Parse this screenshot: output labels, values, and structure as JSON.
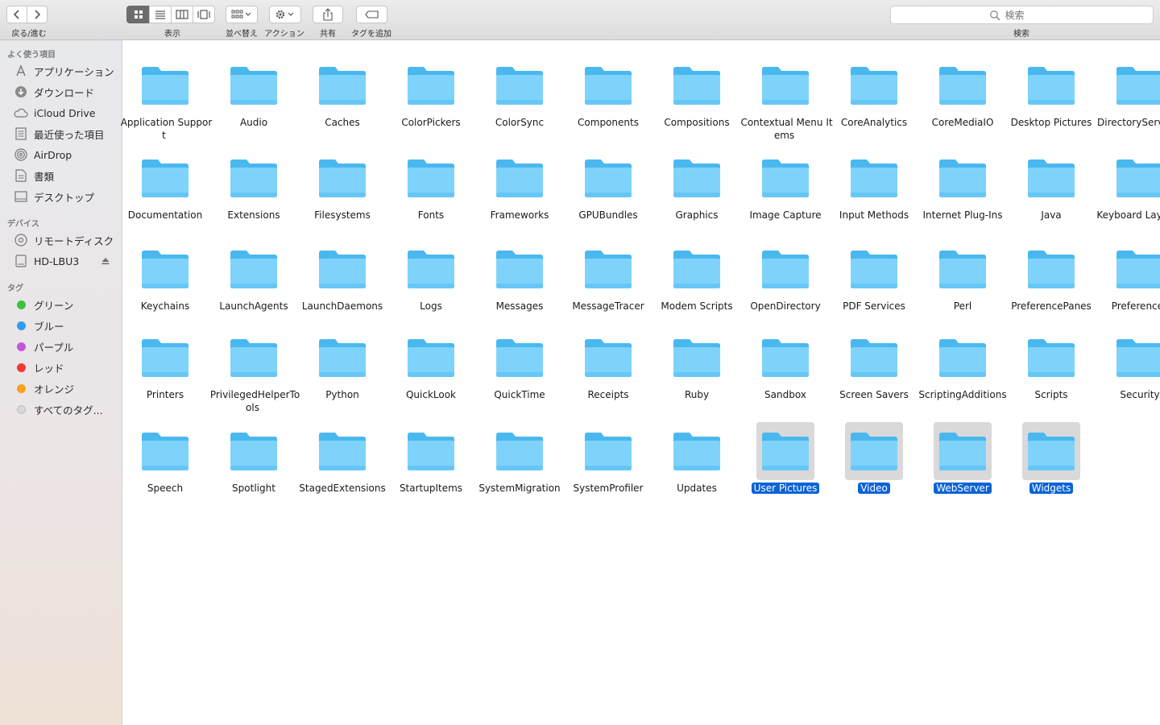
{
  "toolbar": {
    "nav_label": "戻る/進む",
    "view_label": "表示",
    "sort_label": "並べ替え",
    "action_label": "アクション",
    "share_label": "共有",
    "tag_label": "タグを追加",
    "search_label": "検索",
    "search_placeholder": "検索"
  },
  "sidebar": {
    "favorites_header": "よく使う項目",
    "favorites": [
      {
        "label": "アプリケーション",
        "icon": "applications-icon"
      },
      {
        "label": "ダウンロード",
        "icon": "download-icon"
      },
      {
        "label": "iCloud Drive",
        "icon": "cloud-icon"
      },
      {
        "label": "最近使った項目",
        "icon": "recents-icon"
      },
      {
        "label": "AirDrop",
        "icon": "airdrop-icon"
      },
      {
        "label": "書類",
        "icon": "documents-icon"
      },
      {
        "label": "デスクトップ",
        "icon": "desktop-icon"
      }
    ],
    "devices_header": "デバイス",
    "devices": [
      {
        "label": "リモートディスク",
        "icon": "disc-icon"
      },
      {
        "label": "HD-LBU3",
        "icon": "drive-icon"
      }
    ],
    "tags_header": "タグ",
    "tags": [
      {
        "label": "グリーン",
        "color": "#3ec13e"
      },
      {
        "label": "ブルー",
        "color": "#2f9cf0"
      },
      {
        "label": "パープル",
        "color": "#c557d6"
      },
      {
        "label": "レッド",
        "color": "#f23a35"
      },
      {
        "label": "オレンジ",
        "color": "#f7a21c"
      },
      {
        "label": "すべてのタグ...",
        "color": "#d8d8d8"
      }
    ]
  },
  "folders": [
    {
      "name": "Application Support",
      "selected": false
    },
    {
      "name": "Audio",
      "selected": false
    },
    {
      "name": "Caches",
      "selected": false
    },
    {
      "name": "ColorPickers",
      "selected": false
    },
    {
      "name": "ColorSync",
      "selected": false
    },
    {
      "name": "Components",
      "selected": false
    },
    {
      "name": "Compositions",
      "selected": false
    },
    {
      "name": "Contextual Menu Items",
      "selected": false
    },
    {
      "name": "CoreAnalytics",
      "selected": false
    },
    {
      "name": "CoreMediaIO",
      "selected": false
    },
    {
      "name": "Desktop Pictures",
      "selected": false
    },
    {
      "name": "DirectoryServices",
      "selected": false
    },
    {
      "name": "Documentation",
      "selected": false
    },
    {
      "name": "Extensions",
      "selected": false
    },
    {
      "name": "Filesystems",
      "selected": false
    },
    {
      "name": "Fonts",
      "selected": false
    },
    {
      "name": "Frameworks",
      "selected": false
    },
    {
      "name": "GPUBundles",
      "selected": false
    },
    {
      "name": "Graphics",
      "selected": false
    },
    {
      "name": "Image Capture",
      "selected": false
    },
    {
      "name": "Input Methods",
      "selected": false
    },
    {
      "name": "Internet Plug-Ins",
      "selected": false
    },
    {
      "name": "Java",
      "selected": false
    },
    {
      "name": "Keyboard Layouts",
      "selected": false
    },
    {
      "name": "Keychains",
      "selected": false
    },
    {
      "name": "LaunchAgents",
      "selected": false
    },
    {
      "name": "LaunchDaemons",
      "selected": false
    },
    {
      "name": "Logs",
      "selected": false
    },
    {
      "name": "Messages",
      "selected": false
    },
    {
      "name": "MessageTracer",
      "selected": false
    },
    {
      "name": "Modem Scripts",
      "selected": false
    },
    {
      "name": "OpenDirectory",
      "selected": false
    },
    {
      "name": "PDF Services",
      "selected": false
    },
    {
      "name": "Perl",
      "selected": false
    },
    {
      "name": "PreferencePanes",
      "selected": false
    },
    {
      "name": "Preferences",
      "selected": false
    },
    {
      "name": "Printers",
      "selected": false
    },
    {
      "name": "PrivilegedHelperTools",
      "selected": false
    },
    {
      "name": "Python",
      "selected": false
    },
    {
      "name": "QuickLook",
      "selected": false
    },
    {
      "name": "QuickTime",
      "selected": false
    },
    {
      "name": "Receipts",
      "selected": false
    },
    {
      "name": "Ruby",
      "selected": false
    },
    {
      "name": "Sandbox",
      "selected": false
    },
    {
      "name": "Screen Savers",
      "selected": false
    },
    {
      "name": "ScriptingAdditions",
      "selected": false
    },
    {
      "name": "Scripts",
      "selected": false
    },
    {
      "name": "Security",
      "selected": false
    },
    {
      "name": "Speech",
      "selected": false
    },
    {
      "name": "Spotlight",
      "selected": false
    },
    {
      "name": "StagedExtensions",
      "selected": false
    },
    {
      "name": "StartupItems",
      "selected": false
    },
    {
      "name": "SystemMigration",
      "selected": false
    },
    {
      "name": "SystemProfiler",
      "selected": false
    },
    {
      "name": "Updates",
      "selected": false
    },
    {
      "name": "User Pictures",
      "selected": true
    },
    {
      "name": "Video",
      "selected": true
    },
    {
      "name": "WebServer",
      "selected": true
    },
    {
      "name": "Widgets",
      "selected": true
    }
  ],
  "colors": {
    "folder_light": "#7fd3fb",
    "folder_dark": "#4ab8ef",
    "selection": "#0b63d6"
  }
}
